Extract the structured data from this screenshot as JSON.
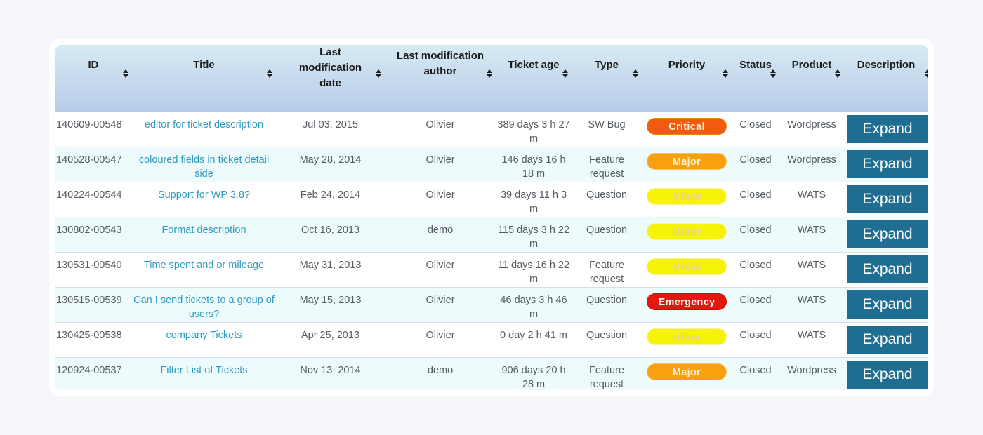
{
  "table": {
    "columns": [
      {
        "key": "id",
        "label": "ID"
      },
      {
        "key": "title",
        "label": "Title"
      },
      {
        "key": "last_mod_date",
        "label": "Last modification date"
      },
      {
        "key": "last_mod_author",
        "label": "Last modification author"
      },
      {
        "key": "ticket_age",
        "label": "Ticket age"
      },
      {
        "key": "type",
        "label": "Type"
      },
      {
        "key": "priority",
        "label": "Priority"
      },
      {
        "key": "status",
        "label": "Status"
      },
      {
        "key": "product",
        "label": "Product"
      },
      {
        "key": "description",
        "label": "Description"
      }
    ],
    "header_lines": {
      "last_mod_date": [
        "Last",
        "modification",
        "date"
      ],
      "last_mod_author": [
        "Last modification",
        "author"
      ]
    },
    "sort_icon": "sort-both-icon",
    "rows": [
      {
        "id": "140609-00548",
        "title": "editor for ticket description",
        "last_mod_date": "Jul 03, 2015",
        "last_mod_author": "Olivier",
        "ticket_age": "389 days 3 h 27 m",
        "type": "SW Bug",
        "priority": "Critical",
        "status": "Closed",
        "product": "Wordpress",
        "description": "Expand"
      },
      {
        "id": "140528-00547",
        "title": "coloured fields in ticket detail side",
        "last_mod_date": "May 28, 2014",
        "last_mod_author": "Olivier",
        "ticket_age": "146 days 16 h 18 m",
        "type": "Feature request",
        "priority": "Major",
        "status": "Closed",
        "product": "Wordpress",
        "description": "Expand"
      },
      {
        "id": "140224-00544",
        "title": "Support for WP 3.8?",
        "last_mod_date": "Feb 24, 2014",
        "last_mod_author": "Olivier",
        "ticket_age": "39 days 11 h 3 m",
        "type": "Question",
        "priority": "Minor",
        "status": "Closed",
        "product": "WATS",
        "description": "Expand"
      },
      {
        "id": "130802-00543",
        "title": "Format description",
        "last_mod_date": "Oct 16, 2013",
        "last_mod_author": "demo",
        "ticket_age": "115 days 3 h 22 m",
        "type": "Question",
        "priority": "Minor",
        "status": "Closed",
        "product": "WATS",
        "description": "Expand"
      },
      {
        "id": "130531-00540",
        "title": "Time spent and or mileage",
        "last_mod_date": "May 31, 2013",
        "last_mod_author": "Olivier",
        "ticket_age": "11 days 16 h 22 m",
        "type": "Feature request",
        "priority": "Minor",
        "status": "Closed",
        "product": "WATS",
        "description": "Expand"
      },
      {
        "id": "130515-00539",
        "title": "Can I send tickets to a group of users?",
        "last_mod_date": "May 15, 2013",
        "last_mod_author": "Olivier",
        "ticket_age": "46 days 3 h 46 m",
        "type": "Question",
        "priority": "Emergency",
        "status": "Closed",
        "product": "WATS",
        "description": "Expand"
      },
      {
        "id": "130425-00538",
        "title": "company Tickets",
        "last_mod_date": "Apr 25, 2013",
        "last_mod_author": "Olivier",
        "ticket_age": "0 day 2 h 41 m",
        "type": "Question",
        "priority": "Minor",
        "status": "Closed",
        "product": "WATS",
        "description": "Expand"
      },
      {
        "id": "120924-00537",
        "title": "Filter List of Tickets",
        "last_mod_date": "Nov 13, 2014",
        "last_mod_author": "demo",
        "ticket_age": "906 days 20 h 28 m",
        "type": "Feature request",
        "priority": "Major",
        "status": "Closed",
        "product": "Wordpress",
        "description": "Expand"
      }
    ]
  },
  "priority_colors": {
    "Critical": "#f25a10",
    "Major": "#f9a010",
    "Minor": "#f7f306",
    "Emergency": "#e4170f"
  },
  "colors": {
    "link": "#2e9bc0",
    "expand_button": "#1f6e91",
    "header_gradient_top": "#d6ebf3",
    "header_gradient_bottom": "#b6cce9",
    "row_alt": "#eefbfd"
  }
}
